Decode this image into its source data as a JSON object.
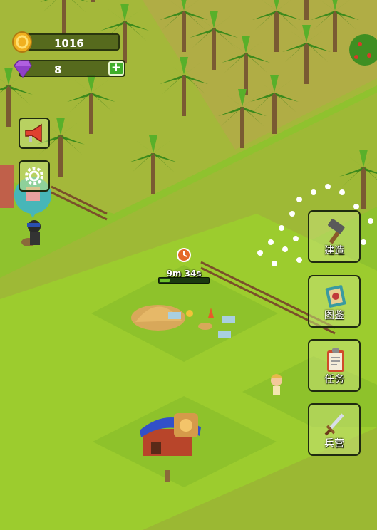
{
  "resources": {
    "coins": "1016",
    "gems": "8",
    "coin_icon": "gold-coin-icon",
    "gem_icon": "purple-gem-icon",
    "add_icon": "plus-icon",
    "add_label": "+"
  },
  "left_buttons": [
    {
      "name": "announcement-button",
      "icon": "megaphone-icon"
    },
    {
      "name": "settings-button",
      "icon": "gear-icon"
    }
  ],
  "menu": {
    "build": {
      "label": "建造",
      "icon": "hammer-icon"
    },
    "catalog": {
      "label": "图鉴",
      "icon": "book-icon"
    },
    "quests": {
      "label": "任务",
      "icon": "clipboard-icon"
    },
    "barracks": {
      "label": "兵营",
      "icon": "sword-icon"
    }
  },
  "construction": {
    "timer": "9m 34s",
    "progress": 0.2
  },
  "colors": {
    "grass": "#8fc22e",
    "field": "#9acd32",
    "path": "#b89a3a",
    "button_border": "#1f2a10",
    "progress": "#6cc02a"
  }
}
